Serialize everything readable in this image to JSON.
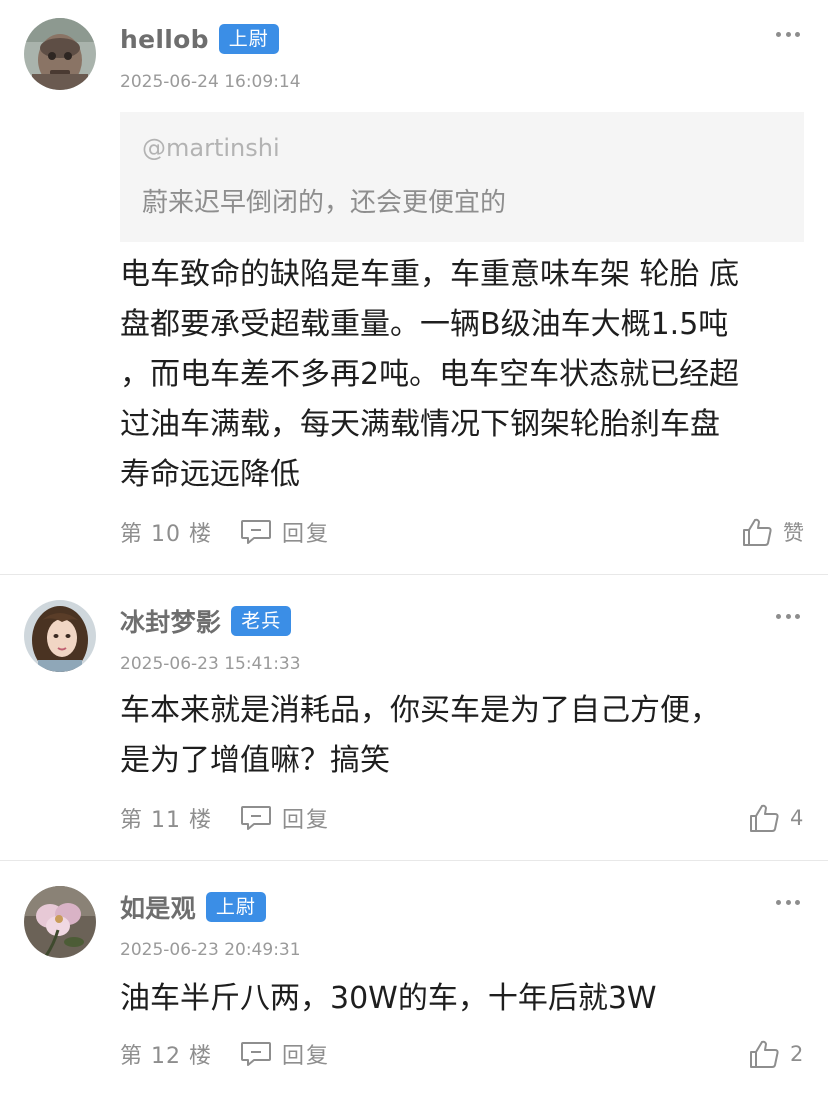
{
  "comments": [
    {
      "username": "hellob",
      "badge": "上尉",
      "time": "2025-06-24 16:09:14",
      "quote": {
        "user": "@martinshi",
        "text": "蔚来迟早倒闭的，还会更便宜的"
      },
      "lines": [
        "电车致命的缺陷是车重，车重意味车架 轮胎 底",
        "盘都要承受超载重量。一辆B级油车大概1.5吨",
        "，而电车差不多再2吨。电车空车状态就已经超",
        "过油车满载，每天满载情况下钢架轮胎刹车盘",
        "寿命远远降低"
      ],
      "floor": "第 10 楼",
      "reply": "回复",
      "like": "赞"
    },
    {
      "username": "冰封梦影",
      "badge": "老兵",
      "time": "2025-06-23 15:41:33",
      "lines": [
        "车本来就是消耗品，你买车是为了自己方便，",
        "是为了增值嘛？搞笑"
      ],
      "floor": "第 11 楼",
      "reply": "回复",
      "like": "4"
    },
    {
      "username": "如是观",
      "badge": "上尉",
      "time": "2025-06-23 20:49:31",
      "lines": [
        "油车半斤八两，30W的车，十年后就3W"
      ],
      "floor": "第 12 楼",
      "reply": "回复",
      "like": "2"
    }
  ],
  "colors": {
    "badge": "#3b8ee6",
    "username": "#6e6e6e",
    "meta": "#9a9a9a",
    "quote_bg": "#f5f5f5"
  },
  "icons": {
    "more": "more-dots-icon",
    "reply": "comment-bubble-icon",
    "like": "thumbs-up-icon"
  }
}
